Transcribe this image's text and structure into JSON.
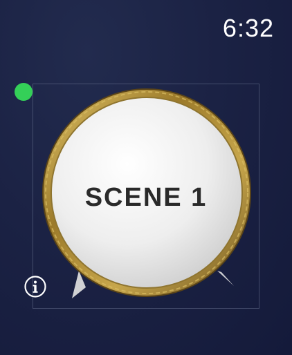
{
  "status": {
    "time": "6:32"
  },
  "scene": {
    "label": "SCENE 1"
  },
  "icons": {
    "indicator": "green-dot-indicator",
    "info": "info-icon"
  },
  "colors": {
    "indicator": "#34d058",
    "ring": "#b4953a",
    "face": "#f3f3f3"
  }
}
